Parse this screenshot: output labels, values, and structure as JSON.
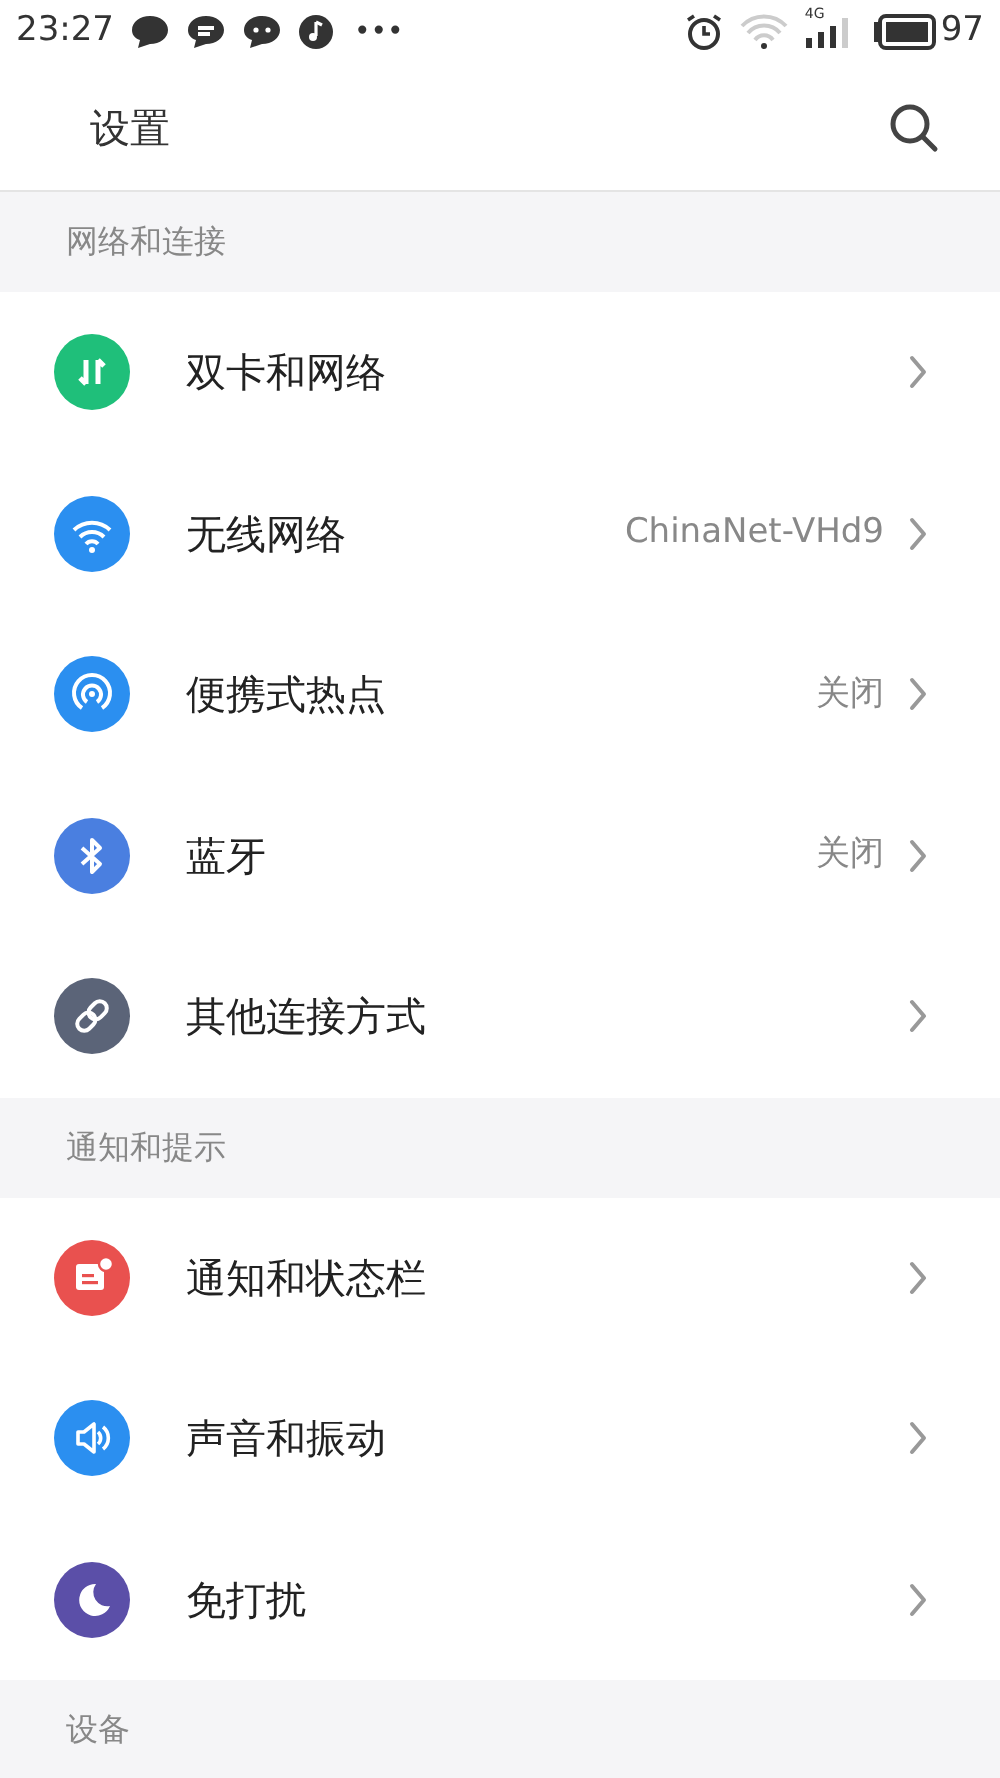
{
  "status_bar": {
    "time": "23:27",
    "more": "•••",
    "network_type": "4G",
    "battery": "97"
  },
  "header": {
    "title": "设置"
  },
  "sections": [
    {
      "title": "网络和连接",
      "items": [
        {
          "kind": "dual-sim",
          "label": "双卡和网络"
        },
        {
          "kind": "wifi",
          "label": "无线网络",
          "value": "ChinaNet-VHd9"
        },
        {
          "kind": "hotspot",
          "label": "便携式热点",
          "value": "关闭"
        },
        {
          "kind": "bluetooth",
          "label": "蓝牙",
          "value": "关闭"
        },
        {
          "kind": "link",
          "label": "其他连接方式"
        }
      ]
    },
    {
      "title": "通知和提示",
      "items": [
        {
          "kind": "notification",
          "label": "通知和状态栏"
        },
        {
          "kind": "sound",
          "label": "声音和振动"
        },
        {
          "kind": "moon",
          "label": "免打扰"
        }
      ]
    },
    {
      "title": "设备"
    }
  ]
}
